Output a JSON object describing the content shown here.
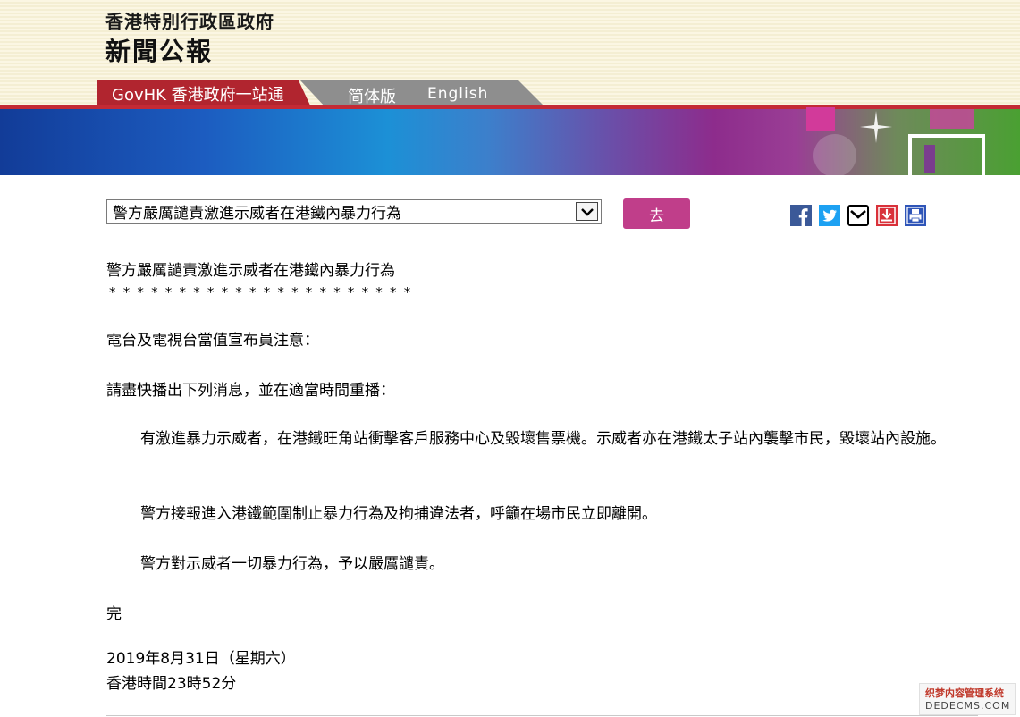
{
  "header": {
    "org_name": "香港特別行政區政府",
    "publication": "新聞公報"
  },
  "nav": {
    "govhk_tab": "GovHK 香港政府一站通",
    "simplified_tab": "简体版",
    "english_tab": "English"
  },
  "toolbar": {
    "select_value": "警方嚴厲譴責激進示威者在港鐵內暴力行為",
    "go_label": "去",
    "share_icons": [
      "facebook-icon",
      "twitter-icon",
      "email-icon",
      "download-icon",
      "print-icon"
    ]
  },
  "article": {
    "title": "警方嚴厲譴責激進示威者在港鐵內暴力行為",
    "stars": "**********************",
    "p1": "電台及電視台當值宣布員注意：",
    "p2": "請盡快播出下列消息，並在適當時間重播：",
    "p3": "有激進暴力示威者，在港鐵旺角站衝擊客戶服務中心及毀壞售票機。示威者亦在港鐵太子站內襲擊市民，毀壞站內設施。",
    "p4": "警方接報進入港鐵範圍制止暴力行為及拘捕違法者，呼籲在場市民立即離開。",
    "p5": "警方對示威者一切暴力行為，予以嚴厲譴責。",
    "end": "完",
    "date": "2019年8月31日（星期六）",
    "time": "香港時間23時52分"
  },
  "watermark": {
    "line1": "织梦内容管理系统",
    "line2": "DEDECMS.COM"
  },
  "colors": {
    "govhk_red": "#b1252f",
    "go_button": "#c03e8a",
    "header_bg": "#fbf7e6"
  }
}
